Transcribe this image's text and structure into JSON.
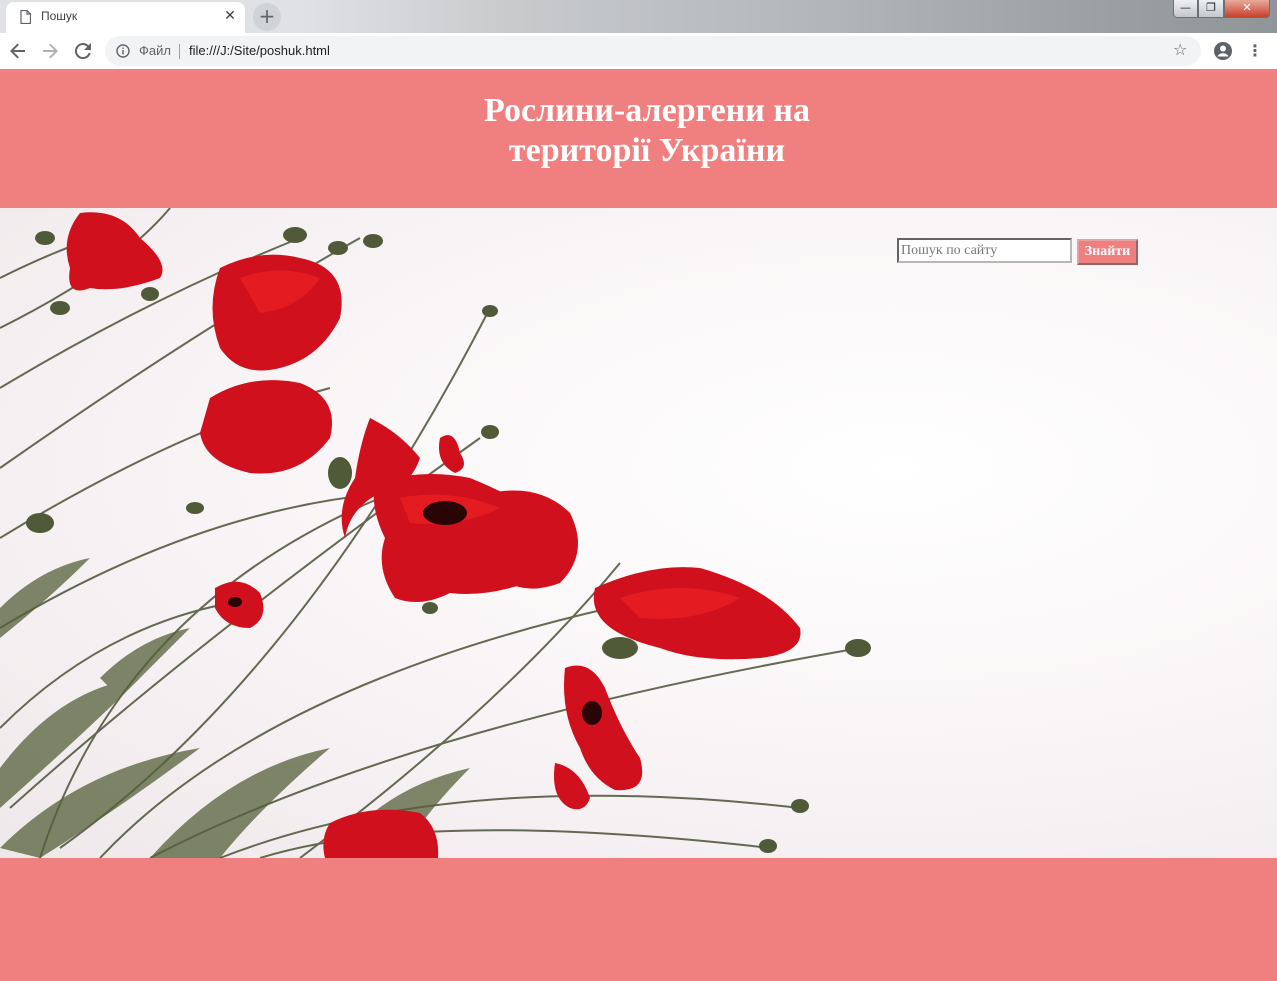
{
  "browser": {
    "tab_title": "Пошук",
    "tab_close": "✕",
    "new_tab": "+",
    "scheme_label": "Файл",
    "url": "file:///J:/Site/poshuk.html",
    "icons": [
      "page-icon",
      "back-icon",
      "forward-icon",
      "reload-icon",
      "info-icon",
      "star-icon",
      "account-icon",
      "menu-icon"
    ]
  },
  "page": {
    "title_line1": "Рослини-алергени на",
    "title_line2": "території України",
    "search": {
      "placeholder": "Пошук по сайту",
      "button_label": "Знайти"
    },
    "hero_image": "red-poppies-photo"
  },
  "colors": {
    "header_bg": "#f08080",
    "title_text": "#ffffff",
    "poppy_red": "#d0101c"
  }
}
